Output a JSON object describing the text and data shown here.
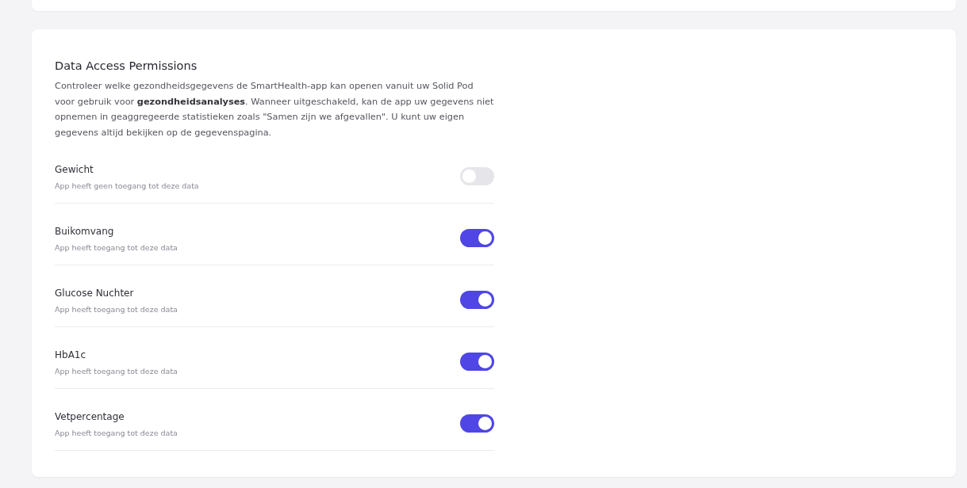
{
  "section": {
    "title": "Data Access Permissions",
    "description": "Controleer welke gezondheidsgegevens de SmartHealth-app kan openen vanuit uw Solid Pod voor gebruik voor **gezondheidsanalyses**. Wanneer uitgeschakeld, kan de app uw gegevens niet opnemen in geaggregeerde statistieken zoals \"Samen zijn we afgevallen\". U kunt uw eigen gegevens altijd bekijken op de gegevenspagina."
  },
  "permissions": [
    {
      "label": "Gewicht",
      "status": "App heeft geen toegang tot deze data",
      "on": false
    },
    {
      "label": "Buikomvang",
      "status": "App heeft toegang tot deze data",
      "on": true
    },
    {
      "label": "Glucose Nuchter",
      "status": "App heeft toegang tot deze data",
      "on": true
    },
    {
      "label": "HbA1c",
      "status": "App heeft toegang tot deze data",
      "on": true
    },
    {
      "label": "Vetpercentage",
      "status": "App heeft toegang tot deze data",
      "on": true
    }
  ]
}
